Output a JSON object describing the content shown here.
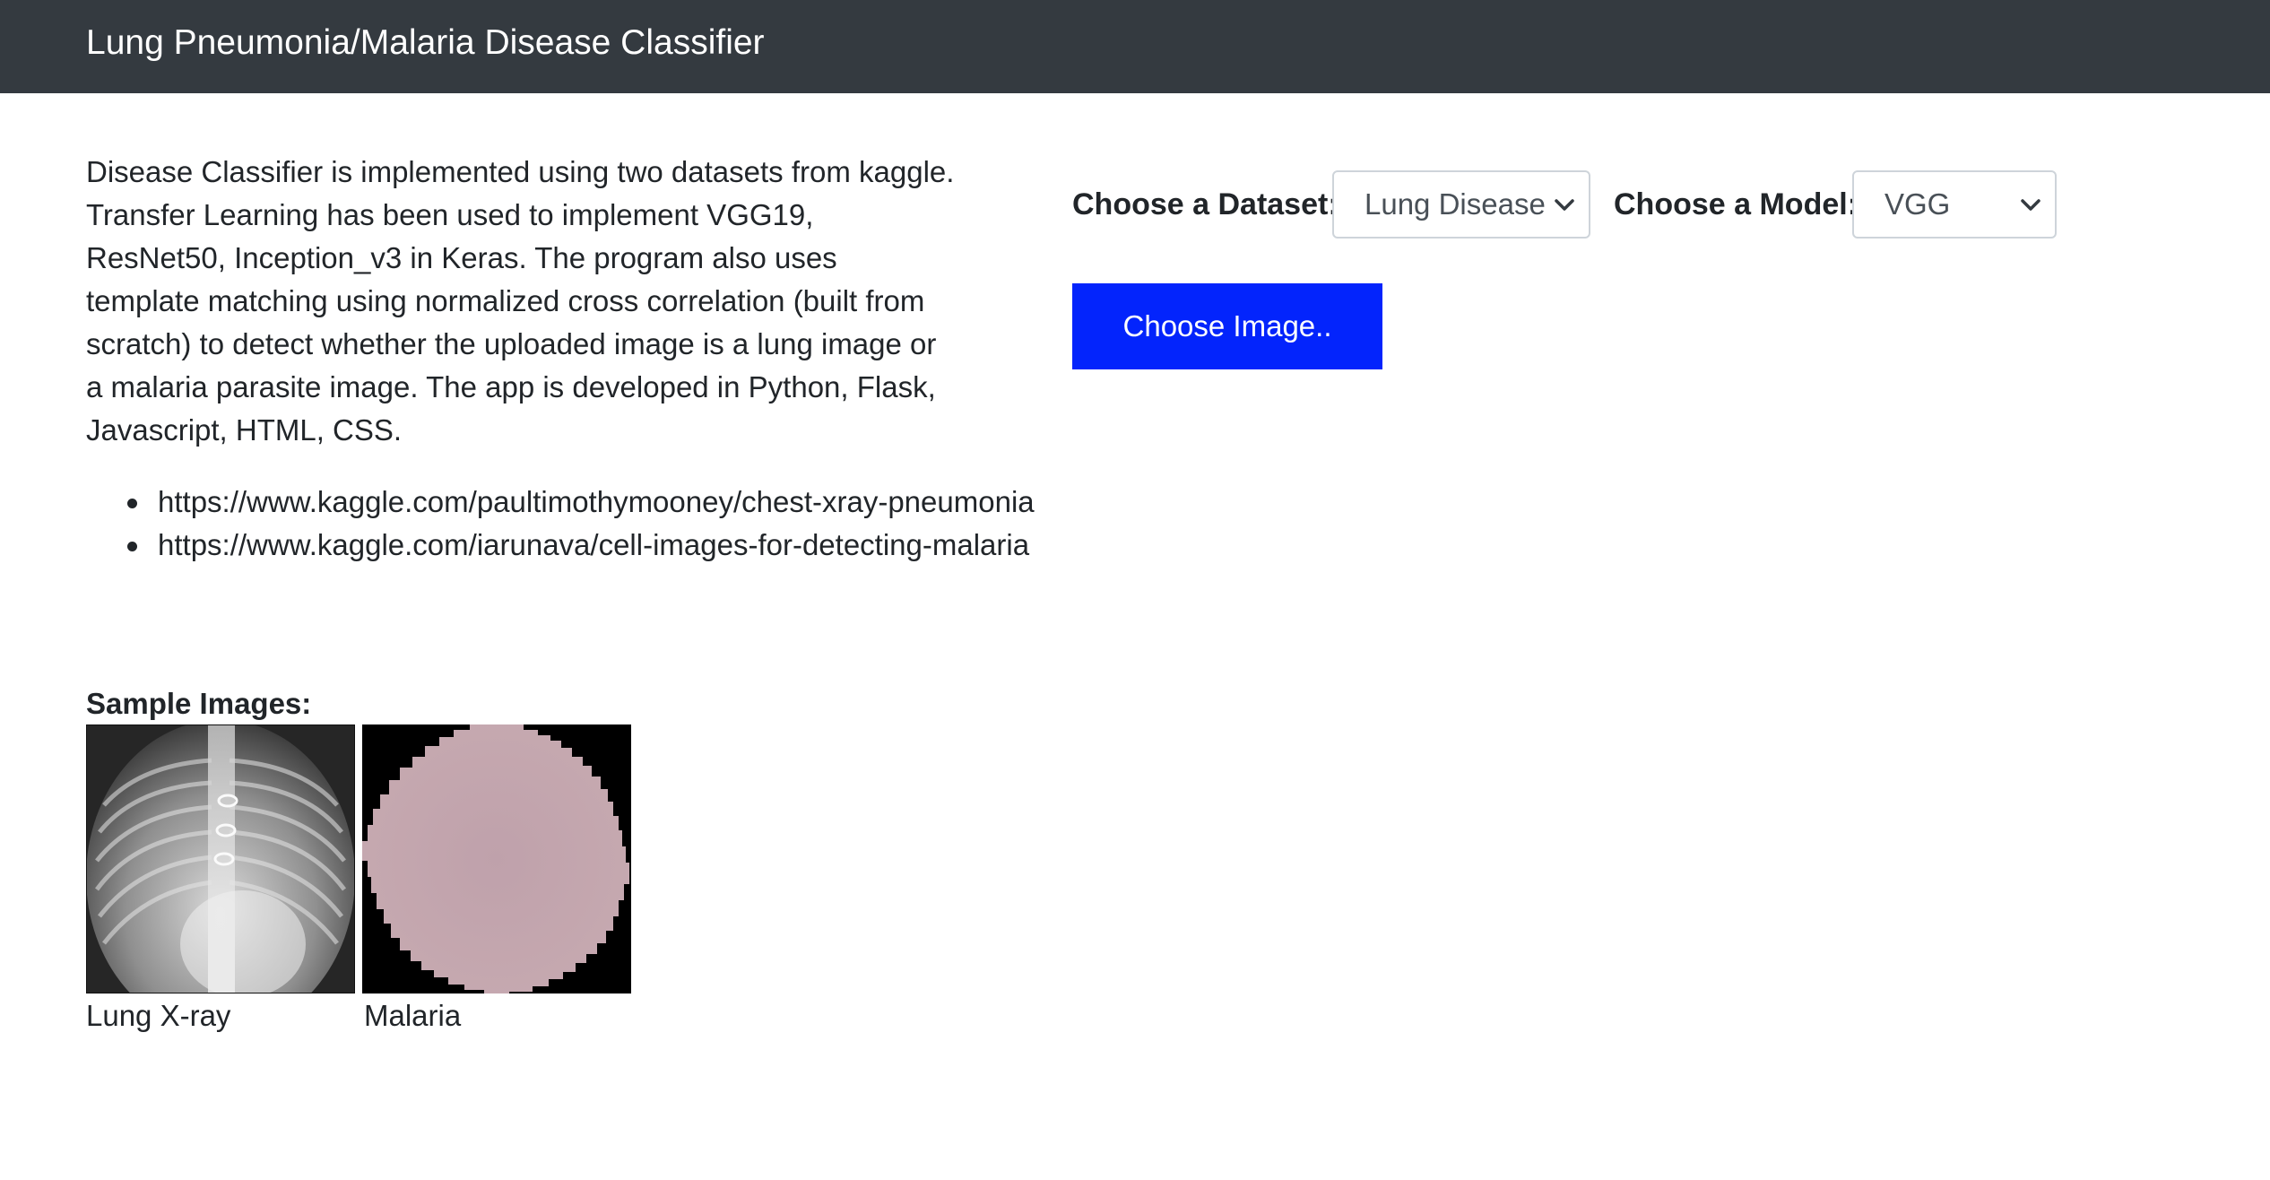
{
  "navbar": {
    "title": "Lung Pneumonia/Malaria Disease Classifier"
  },
  "description": "Disease Classifier is implemented using two datasets from kaggle. Transfer Learning has been used to implement VGG19, ResNet50, Inception_v3 in Keras. The program also uses template matching using normalized cross correlation (built from scratch) to detect whether the uploaded image is a lung image or a malaria parasite image. The app is developed in Python, Flask, Javascript, HTML, CSS.",
  "links": [
    "https://www.kaggle.com/paultimothymooney/chest-xray-pneumonia",
    "https://www.kaggle.com/iarunava/cell-images-for-detecting-malaria"
  ],
  "samples": {
    "label": "Sample Images:",
    "xray_caption": "Lung X-ray",
    "malaria_caption": "Malaria"
  },
  "controls": {
    "dataset_label": "Choose a Dataset:",
    "dataset_value": "Lung Disease",
    "model_label": "Choose a Model:",
    "model_value": "VGG",
    "choose_button": "Choose Image.."
  },
  "icons": {
    "select_arrow": "chevron-down-icon"
  },
  "colors": {
    "navbar_bg": "#343a40",
    "button_bg": "#0324fc",
    "malaria_cell": "#b89aa6"
  }
}
